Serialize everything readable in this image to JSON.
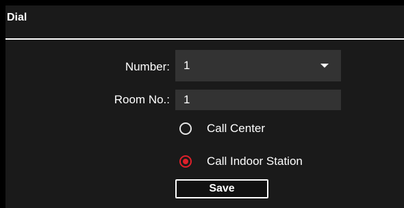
{
  "section": {
    "title": "Dial"
  },
  "form": {
    "number": {
      "label": "Number:",
      "value": "1"
    },
    "room": {
      "label": "Room No.:",
      "value": "1"
    },
    "call_options": [
      {
        "label": "Call Center",
        "checked": false
      },
      {
        "label": "Call Indoor Station",
        "checked": true
      }
    ],
    "save_label": "Save"
  },
  "colors": {
    "background": "#000000",
    "panel": "#1a1a1a",
    "field": "#333333",
    "accent_radio": "#e0202a",
    "text": "#ffffff"
  }
}
